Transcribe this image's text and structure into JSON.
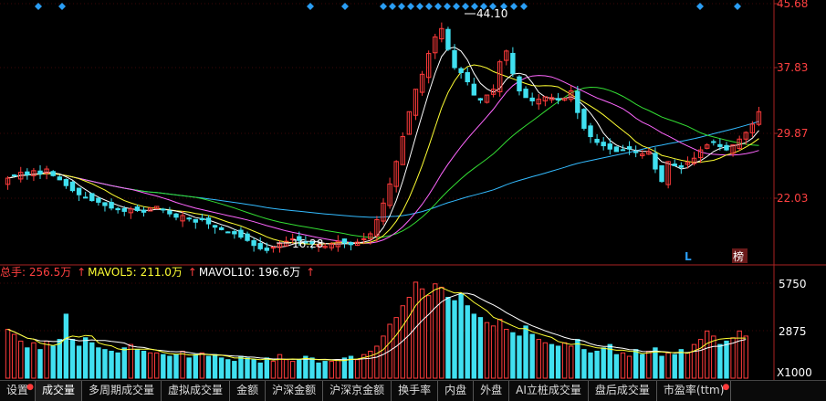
{
  "chart_data": [
    {
      "type": "candlestick",
      "y_ticks": [
        "45.68",
        "37.83",
        "29.87",
        "22.03"
      ],
      "annotations": {
        "high": "44.10",
        "low": "16.28"
      },
      "markers": [
        "L",
        "榜"
      ],
      "ylim": [
        15.5,
        46.5
      ],
      "ma_colors": {
        "ma5": "#ffffff",
        "ma10": "#ffff33",
        "ma20": "#ff66ff",
        "ma30": "#33dd33",
        "ma60": "#33bbff"
      },
      "close_series": [
        25.5,
        25.8,
        26.2,
        25.9,
        26.4,
        26.0,
        26.6,
        25.8,
        25.3,
        24.6,
        24.0,
        23.5,
        23.2,
        22.8,
        22.6,
        22.2,
        21.9,
        21.7,
        21.5,
        21.8,
        21.6,
        21.4,
        21.9,
        22.1,
        21.7,
        21.2,
        20.8,
        21.0,
        20.6,
        20.2,
        20.5,
        20.0,
        19.6,
        19.3,
        19.0,
        18.8,
        18.4,
        18.0,
        17.4,
        17.0,
        16.8,
        17.2,
        17.6,
        17.9,
        18.2,
        18.0,
        17.8,
        17.6,
        17.5,
        17.3,
        17.6,
        17.9,
        17.7,
        17.5,
        17.8,
        18.2,
        18.8,
        20.5,
        22.5,
        24.8,
        27.5,
        30.5,
        33.5,
        36.2,
        38.0,
        40.5,
        42.5,
        43.5,
        41.0,
        38.8,
        38.2,
        37.1,
        35.5,
        34.9,
        35.5,
        36.2,
        39.5,
        40.8,
        38.1,
        36.0,
        35.2,
        34.8,
        35.0,
        35.3,
        35.2,
        34.9,
        35.1,
        36.0,
        33.4,
        31.5,
        30.5,
        29.8,
        29.4,
        29.0,
        28.7,
        28.9,
        29.0,
        28.6,
        28.4,
        28.7,
        26.6,
        25.1,
        27.5,
        27.0,
        26.8,
        27.4,
        27.9,
        28.9,
        29.5,
        29.8,
        29.3,
        28.9,
        29.5,
        30.2,
        31.0,
        32.0,
        33.5
      ],
      "volume": {
        "ylim": [
          0,
          6400
        ],
        "y_ticks": [
          "5750",
          "2875"
        ],
        "unit_label": "X1000",
        "bars": [
          2900,
          2600,
          2200,
          1800,
          2100,
          1700,
          2200,
          1900,
          2300,
          3800,
          2300,
          1900,
          2400,
          2100,
          1800,
          1700,
          1600,
          1500,
          1800,
          2000,
          1700,
          1600,
          1500,
          1500,
          1400,
          1300,
          1400,
          1600,
          1200,
          1400,
          1500,
          1300,
          1400,
          1200,
          1100,
          1000,
          1300,
          1200,
          1100,
          900,
          1200,
          1000,
          1400,
          1100,
          1000,
          1100,
          1300,
          1200,
          900,
          1000,
          1000,
          1100,
          1200,
          1300,
          1100,
          1400,
          1600,
          1900,
          2500,
          3200,
          3600,
          4300,
          4800,
          5700,
          5300,
          4900,
          5600,
          5400,
          4800,
          4600,
          5000,
          4300,
          3800,
          3600,
          3300,
          3100,
          3500,
          2900,
          2700,
          2500,
          3100,
          2600,
          2300,
          2100,
          2000,
          1900,
          2100,
          1900,
          2300,
          1700,
          1500,
          1600,
          1800,
          2000,
          1400,
          1500,
          1300,
          1700,
          1400,
          1600,
          1800,
          1300,
          1500,
          1400,
          1700,
          1500,
          2000,
          2300,
          2800,
          2500,
          2000,
          2200,
          2400,
          2800,
          2500
        ]
      },
      "volume_legend": {
        "total_label": "总手:",
        "total_value": "256.5万",
        "mavol5_label": "MAVOL5:",
        "mavol5_value": "211.0万",
        "mavol10_label": "MAVOL10:",
        "mavol10_value": "196.6万"
      }
    }
  ],
  "tabs": [
    "设置",
    "成交量",
    "多周期成交量",
    "虚拟成交量",
    "金额",
    "沪深金额",
    "沪深京金额",
    "换手率",
    "内盘",
    "外盘",
    "AI立桩成交量",
    "盘后成交量",
    "市盈率(ttm)"
  ],
  "colors": {
    "up": "#ff3b3b",
    "down": "#40e0f0",
    "axis": "#aa2222",
    "grid": "#7a1010",
    "tick_text": "#ff4040",
    "marker": "#2a9df4"
  }
}
